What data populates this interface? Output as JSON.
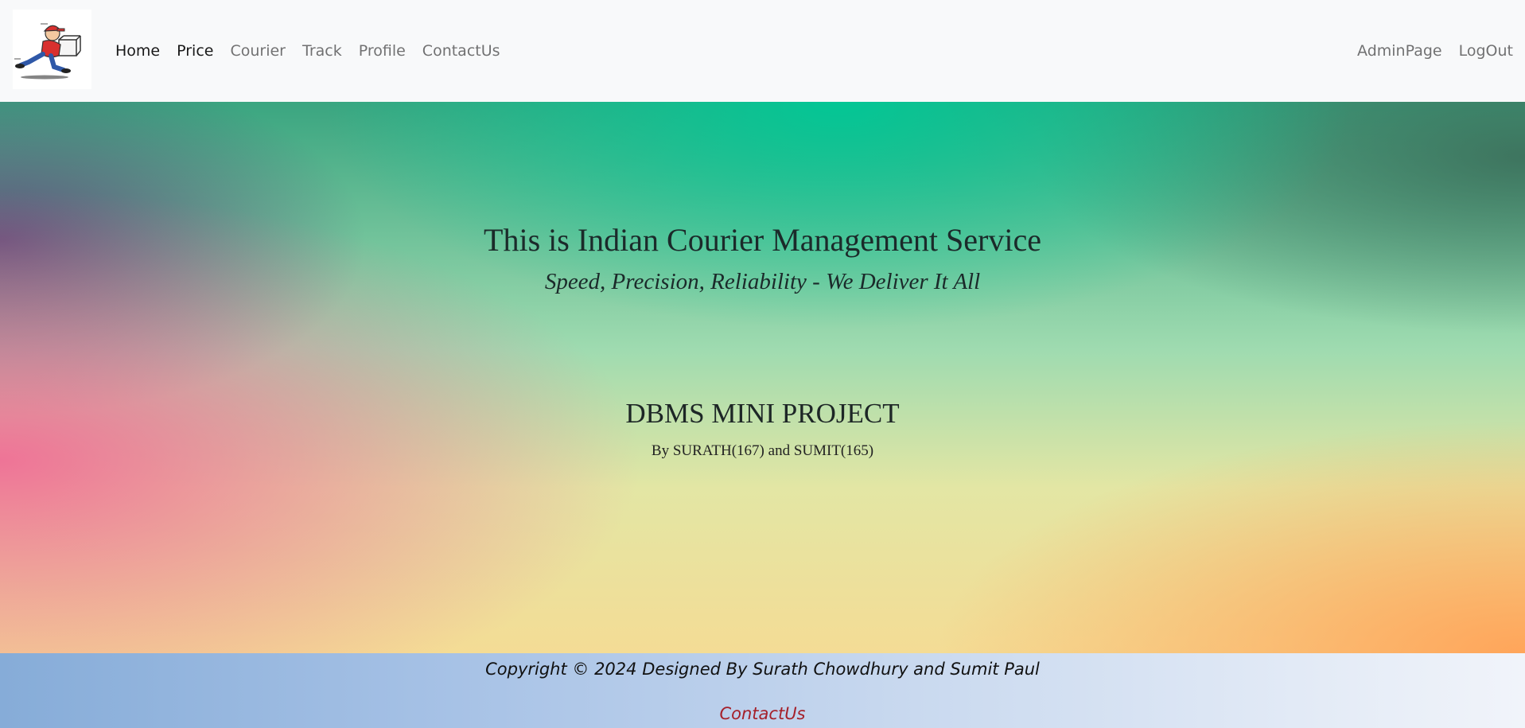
{
  "navbar": {
    "logo": "courier-delivery-man-logo",
    "links": [
      {
        "label": "Home",
        "active": true
      },
      {
        "label": "Price",
        "active": true
      },
      {
        "label": "Courier",
        "active": false
      },
      {
        "label": "Track",
        "active": false
      },
      {
        "label": "Profile",
        "active": false
      },
      {
        "label": "ContactUs",
        "active": false
      }
    ],
    "right_links": [
      {
        "label": "AdminPage"
      },
      {
        "label": "LogOut"
      }
    ]
  },
  "hero": {
    "title": "This is Indian Courier Management Service",
    "subtitle": "Speed, Precision, Reliability - We Deliver It All",
    "project_title": "DBMS MINI PROJECT",
    "project_authors": "By SURATH(167) and SUMIT(165)"
  },
  "footer": {
    "copyright": "Copyright © 2024 Designed By Surath Chowdhury and Sumit Paul",
    "contact_link": "ContactUs"
  },
  "colors": {
    "navbar_bg": "#f8f9fa",
    "footer_link": "#a5202a"
  }
}
